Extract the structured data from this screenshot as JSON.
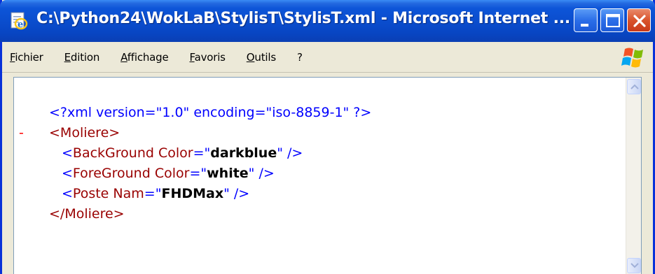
{
  "window": {
    "title": "C:\\Python24\\WokLaB\\StylisT\\StylisT.xml - Microsoft Internet ..."
  },
  "menu": {
    "items": [
      {
        "label": "Fichier"
      },
      {
        "label": "Edition"
      },
      {
        "label": "Affichage"
      },
      {
        "label": "Favoris"
      },
      {
        "label": "Outils"
      },
      {
        "label": "?"
      }
    ]
  },
  "xml": {
    "declaration": "<?xml version=\"1.0\" encoding=\"iso-8859-1\" ?>",
    "collapse_marker": "-",
    "root_open": "<Moliere>",
    "root_close": "</Moliere>",
    "children": [
      {
        "tag": "BackGround",
        "attr": "Color",
        "value": "darkblue"
      },
      {
        "tag": "ForeGround",
        "attr": "Color",
        "value": "white"
      },
      {
        "tag": "Poste",
        "attr": "Nam",
        "value": "FHDMax"
      }
    ]
  },
  "colors": {
    "titlebar": "#0a4ccc",
    "close_button": "#d9532c",
    "xml_pi": "#0000ff",
    "xml_tag": "#990000",
    "collapse_marker": "#ff0000"
  },
  "icons": {
    "app": "ie-document-icon",
    "minimize": "minimize-icon",
    "maximize": "maximize-icon",
    "close": "close-icon",
    "throbber": "windows-flag-icon",
    "scroll_up": "chevron-up-icon",
    "scroll_down": "chevron-down-icon"
  }
}
